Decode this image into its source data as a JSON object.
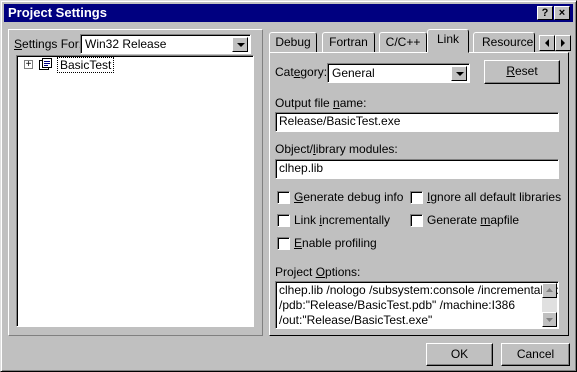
{
  "window": {
    "title": "Project Settings",
    "help_glyph": "?",
    "close_glyph": "×"
  },
  "settings_for": {
    "label_prefix": "",
    "label_hot": "S",
    "label_rest": "ettings For:",
    "value": "Win32 Release"
  },
  "tree": {
    "expander": "+",
    "root_label": "BasicTest"
  },
  "tabs": [
    {
      "label": "Debug"
    },
    {
      "label": "Fortran"
    },
    {
      "label": "C/C++"
    },
    {
      "label": "Link"
    },
    {
      "label": "Resource"
    }
  ],
  "active_tab": "Link",
  "link": {
    "category_label_pre": "Cat",
    "category_label_hot": "e",
    "category_label_post": "gory:",
    "category_value": "General",
    "reset_hot": "R",
    "reset_rest": "eset",
    "output_label_pre": "Output file ",
    "output_label_hot": "n",
    "output_label_post": "ame:",
    "output_value": "Release/BasicTest.exe",
    "objlib_label_pre": "Object/",
    "objlib_label_hot": "l",
    "objlib_label_post": "ibrary modules:",
    "objlib_value": "clhep.lib",
    "checkboxes": {
      "debug_info": {
        "pre": "",
        "hot": "G",
        "post": "enerate debug info",
        "checked": false
      },
      "ignore_libs": {
        "pre": "",
        "hot": "I",
        "post": "gnore all default libraries",
        "checked": false
      },
      "incremental": {
        "pre": "Link ",
        "hot": "i",
        "post": "ncrementally",
        "checked": false
      },
      "mapfile": {
        "pre": "Generate ",
        "hot": "m",
        "post": "apfile",
        "checked": false
      },
      "profiling": {
        "pre": "",
        "hot": "E",
        "post": "nable profiling",
        "checked": false
      }
    },
    "options_label_pre": "Project ",
    "options_label_hot": "O",
    "options_label_post": "ptions:",
    "options_lines": [
      "clhep.lib /nologo /subsystem:console /incremental:no",
      "/pdb:\"Release/BasicTest.pdb\" /machine:I386",
      "/out:\"Release/BasicTest.exe\""
    ]
  },
  "footer": {
    "ok_label": "OK",
    "cancel_label": "Cancel"
  }
}
